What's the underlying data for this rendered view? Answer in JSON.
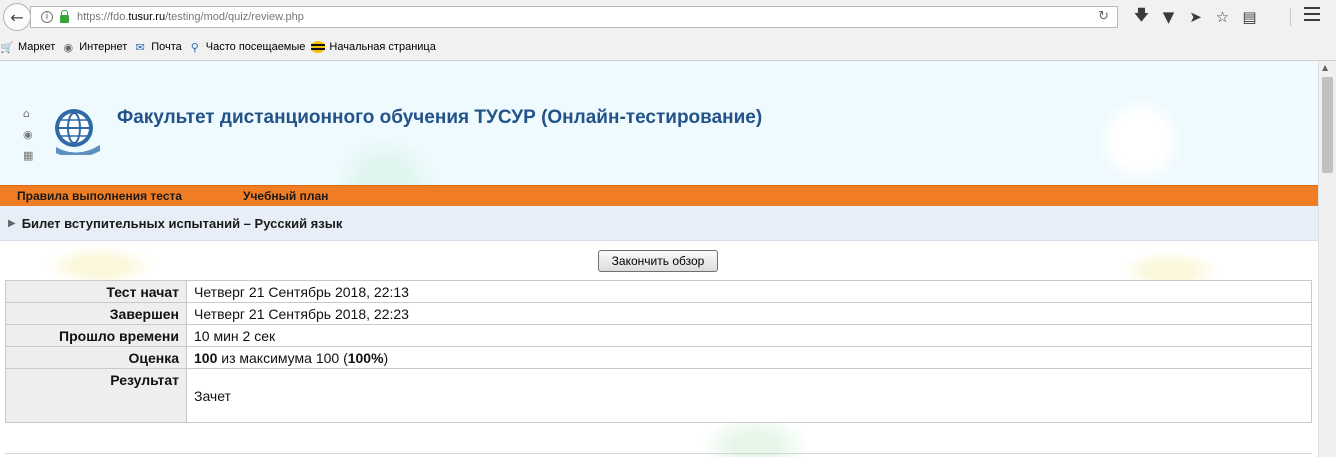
{
  "browser": {
    "url_prefix": "https://fdo.",
    "url_domain": "tusur.ru",
    "url_path": "/testing/mod/quiz/review.php",
    "bookmarks": [
      {
        "label": "Маркет",
        "icon": "cart-icon"
      },
      {
        "label": "Интернет",
        "icon": "globe-icon"
      },
      {
        "label": "Почта",
        "icon": "mail-icon"
      },
      {
        "label": "Часто посещаемые",
        "icon": "search-icon"
      },
      {
        "label": "Начальная страница",
        "icon": "bee-icon"
      }
    ]
  },
  "site": {
    "title": "Факультет дистанционного обучения ТУСУР (Онлайн-тестирование)"
  },
  "nav": {
    "item1": "Правила выполнения теста",
    "item2": "Учебный план"
  },
  "breadcrumb": "Билет вступительных испытаний – Русский язык",
  "finish_button": "Закончить обзор",
  "summary": {
    "rows": [
      {
        "key": "Тест начат",
        "value": "Четверг 21 Сентябрь 2018, 22:13"
      },
      {
        "key": "Завершен",
        "value": "Четверг 21 Сентябрь 2018, 22:23"
      },
      {
        "key": "Прошло времени",
        "value": "10 мин 2 сек"
      }
    ],
    "grade_key": "Оценка",
    "grade_score": "100",
    "grade_mid": " из максимума 100 (",
    "grade_pct": "100%",
    "grade_end": ")",
    "result_key": "Результат",
    "result_value": "Зачет"
  },
  "colors": {
    "nav_bg": "#f07d24",
    "title": "#235389",
    "header_bg": "#eefafd"
  }
}
